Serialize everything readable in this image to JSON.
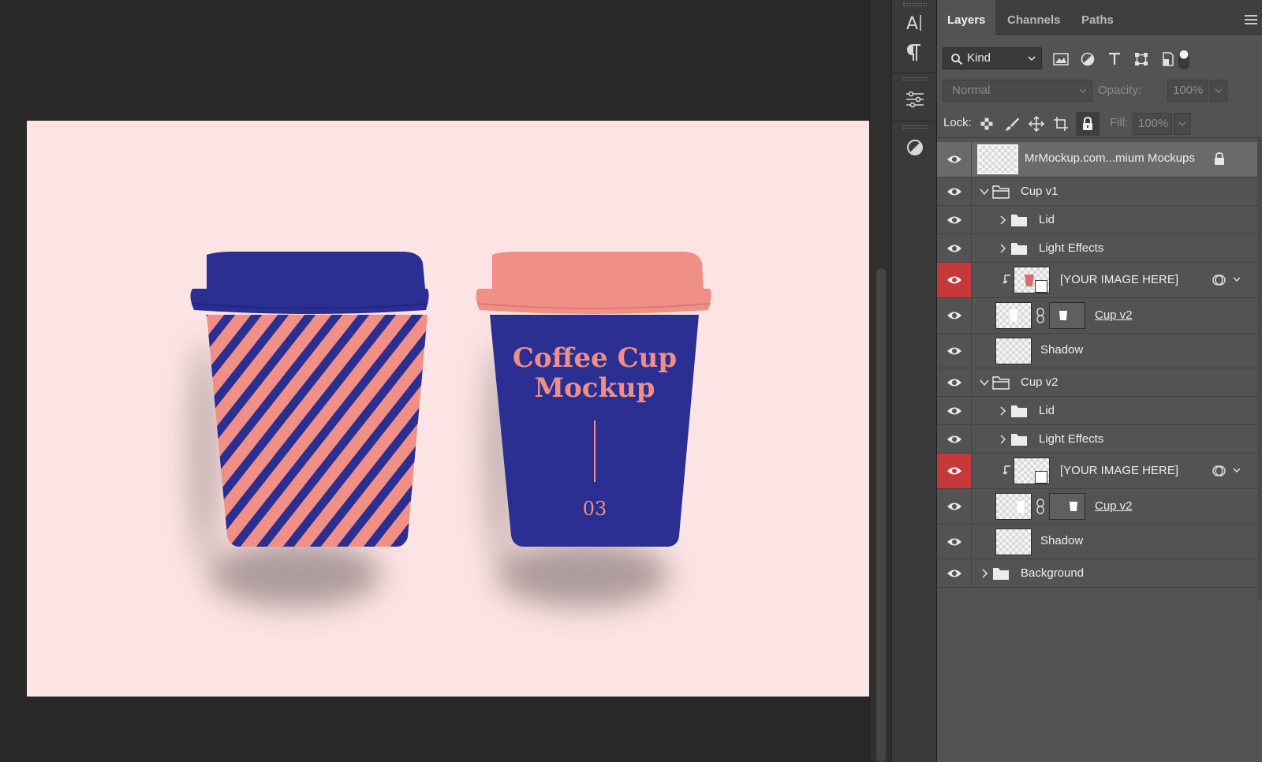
{
  "tool_strip": {
    "tools": [
      {
        "name": "character-panel-icon"
      },
      {
        "name": "paragraph-panel-icon"
      },
      {
        "name": "adjustments-panel-icon"
      },
      {
        "name": "color-contrast-icon"
      }
    ]
  },
  "canvas": {
    "background_color": "#fde4e4",
    "cup_blue": "#2b2f92",
    "cup_pink": "#ef8f86",
    "text": {
      "line1": "Coffee Cup",
      "line2": "Mockup",
      "number": "03"
    }
  },
  "panel": {
    "tabs": [
      {
        "label": "Layers",
        "active": true
      },
      {
        "label": "Channels",
        "active": false
      },
      {
        "label": "Paths",
        "active": false
      }
    ],
    "filter": {
      "kind_label": "Kind",
      "icons": [
        "pixel-layer-filter-icon",
        "adjustment-layer-filter-icon",
        "type-layer-filter-icon",
        "shape-layer-filter-icon",
        "smart-object-filter-icon",
        "filter-toggle-icon"
      ]
    },
    "blend": {
      "mode": "Normal",
      "opacity_label": "Opacity:",
      "opacity_value": "100%"
    },
    "lock": {
      "label": "Lock:",
      "fill_label": "Fill:",
      "fill_value": "100%",
      "icons": [
        "lock-transparent-pixels-icon",
        "lock-image-pixels-icon",
        "lock-position-icon",
        "lock-artboard-icon",
        "lock-all-icon"
      ]
    },
    "layers": [
      {
        "name": "MrMockup.com...mium Mockups",
        "kind": "pixel-locked",
        "indent": 0,
        "selected": true
      },
      {
        "name": "Cup v1",
        "kind": "group-open",
        "indent": 0
      },
      {
        "name": "Lid",
        "kind": "group-closed",
        "indent": 1
      },
      {
        "name": "Light Effects",
        "kind": "group-closed",
        "indent": 1
      },
      {
        "name": "[YOUR IMAGE HERE]",
        "kind": "smart-clipped",
        "indent": 1,
        "highlight": true
      },
      {
        "name": "Cup v2",
        "kind": "masked",
        "indent": 1,
        "underline": true
      },
      {
        "name": "Shadow",
        "kind": "pixel",
        "indent": 1
      },
      {
        "name": "Cup v2",
        "kind": "group-open",
        "indent": 0
      },
      {
        "name": "Lid",
        "kind": "group-closed",
        "indent": 1
      },
      {
        "name": "Light Effects",
        "kind": "group-closed",
        "indent": 1
      },
      {
        "name": "[YOUR IMAGE HERE]",
        "kind": "smart-clipped",
        "indent": 1,
        "highlight": true
      },
      {
        "name": "Cup v2",
        "kind": "masked",
        "indent": 1,
        "underline": true
      },
      {
        "name": "Shadow",
        "kind": "pixel",
        "indent": 1
      },
      {
        "name": "Background",
        "kind": "group-closed",
        "indent": 0
      }
    ]
  }
}
